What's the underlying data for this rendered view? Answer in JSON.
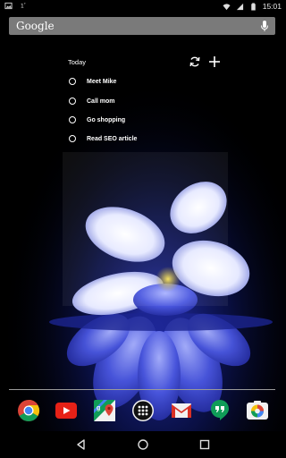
{
  "status_bar": {
    "time": "15:01",
    "notification_icons": [
      "image-icon",
      "sync-icon"
    ],
    "system_icons": [
      "wifi-icon",
      "signal-icon",
      "battery-icon"
    ]
  },
  "search": {
    "brand": "Google",
    "mic_icon": "mic-icon"
  },
  "todo_widget": {
    "title": "Today",
    "refresh_icon": "refresh-icon",
    "add_icon": "add-icon",
    "items": [
      {
        "label": "Meet Mike"
      },
      {
        "label": "Call mom"
      },
      {
        "label": "Go shopping"
      },
      {
        "label": "Read SEO article"
      }
    ]
  },
  "dock": {
    "apps": [
      {
        "name": "Chrome",
        "icon": "chrome-icon"
      },
      {
        "name": "YouTube",
        "icon": "youtube-icon"
      },
      {
        "name": "Maps",
        "icon": "maps-icon"
      },
      {
        "name": "Apps",
        "icon": "app-drawer-icon"
      },
      {
        "name": "Gmail",
        "icon": "gmail-icon"
      },
      {
        "name": "Hangouts",
        "icon": "hangouts-icon"
      },
      {
        "name": "Photos",
        "icon": "photos-icon"
      }
    ]
  },
  "nav": {
    "buttons": [
      "back-icon",
      "home-icon",
      "recents-icon"
    ]
  },
  "colors": {
    "wallpaper_glow": "#2a35c8",
    "flower_white": "#f2f4ff",
    "flower_center": "#e8c830",
    "search_bar": "#7a7a7a"
  }
}
